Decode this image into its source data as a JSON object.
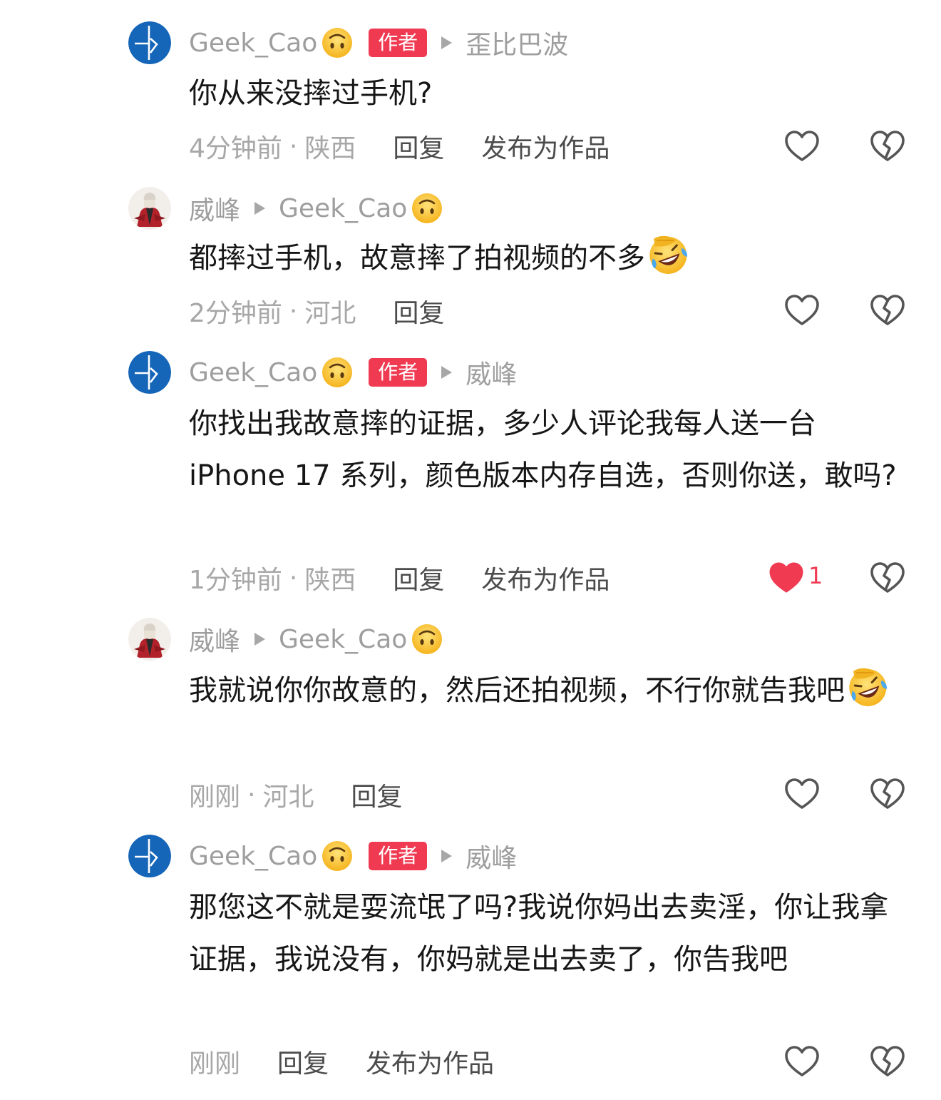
{
  "comments": [
    {
      "author": "Geek_Cao",
      "is_author": true,
      "author_badge": "作者",
      "reply_to": "歪比巴波",
      "text": "你从来没摔过手机?",
      "time": "4分钟前",
      "location": "陕西",
      "reply_label": "回复",
      "publish_label": "发布为作品",
      "liked": false
    },
    {
      "author": "威峰",
      "is_author": false,
      "reply_to": "Geek_Cao",
      "text": "都摔过手机，故意摔了拍视频的不多",
      "time": "2分钟前",
      "location": "河北",
      "reply_label": "回复",
      "liked": false
    },
    {
      "author": "Geek_Cao",
      "is_author": true,
      "author_badge": "作者",
      "reply_to": "威峰",
      "text": "你找出我故意摔的证据，多少人评论我每人送一台iPhone 17 系列，颜色版本内存自选，否则你送，敢吗?",
      "time": "1分钟前",
      "location": "陕西",
      "reply_label": "回复",
      "publish_label": "发布为作品",
      "liked": true,
      "like_count": "1"
    },
    {
      "author": "威峰",
      "is_author": false,
      "reply_to": "Geek_Cao",
      "text": "我就说你你故意的，然后还拍视频，不行你就告我吧",
      "time": "刚刚",
      "location": "河北",
      "reply_label": "回复",
      "liked": false
    },
    {
      "author": "Geek_Cao",
      "is_author": true,
      "author_badge": "作者",
      "reply_to": "威峰",
      "text": "那您这不就是耍流氓了吗?我说你妈出去卖淫，你让我拿证据，我说没有，你妈就是出去卖了，你告我吧",
      "time": "刚刚",
      "reply_label": "回复",
      "publish_label": "发布为作品",
      "liked": false
    }
  ],
  "icons": {
    "separator": "·",
    "reply_arrow": "triangle-right-icon",
    "like": "heart-outline-icon",
    "liked": "heart-filled-icon",
    "dislike": "broken-heart-icon",
    "upside_down_face": "upside-down-face-emoji",
    "rofl": "rofl-emoji"
  },
  "colors": {
    "author_badge_bg": "#f03a52",
    "like_red": "#f03a52",
    "meta_gray": "#a7a7a7",
    "name_gray": "#9e9e9e",
    "action_dark": "#4c4c4c",
    "text": "#161616"
  }
}
